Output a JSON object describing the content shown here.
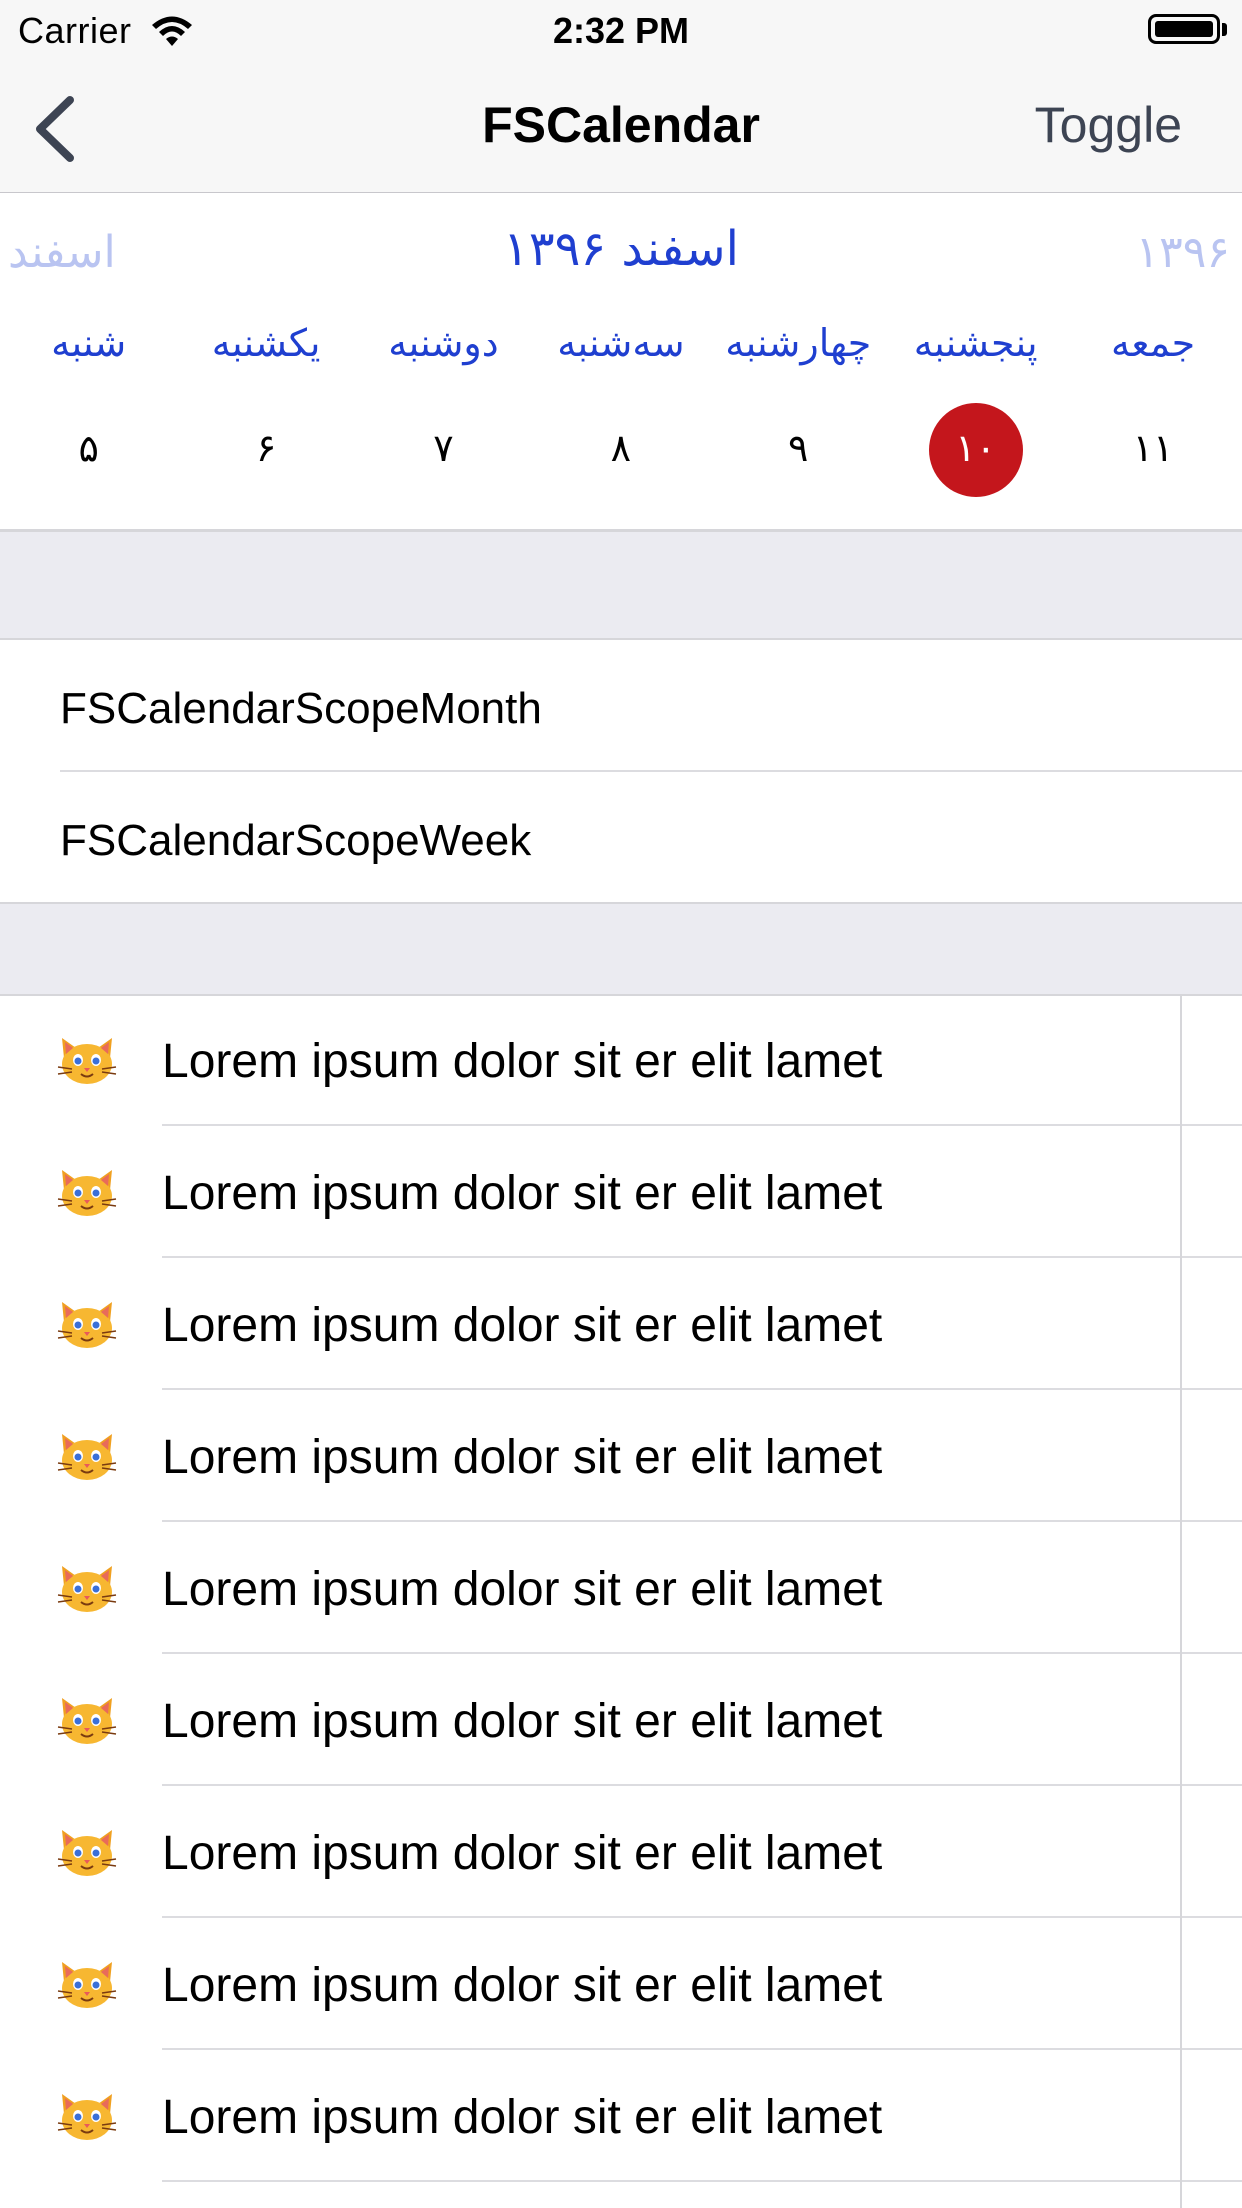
{
  "status_bar": {
    "carrier": "Carrier",
    "time": "2:32 PM"
  },
  "nav": {
    "title": "FSCalendar",
    "toggle_label": "Toggle"
  },
  "calendar": {
    "prev_label": "اسفند",
    "title": "اسفند ۱۳۹۶",
    "next_label": "۱۳۹۶",
    "weekdays": [
      "شنبه",
      "یکشنبه",
      "دوشنبه",
      "سه‌شنبه",
      "چهارشنبه",
      "پنجشنبه",
      "جمعه"
    ],
    "days": [
      "۵",
      "۶",
      "۷",
      "۸",
      "۹",
      "۱۰",
      "۱۱"
    ],
    "selected_day": "۱۰",
    "accent_color": "#1f3fd0",
    "today_color": "#c4161c"
  },
  "scope_options": [
    "FSCalendarScopeMonth",
    "FSCalendarScopeWeek"
  ],
  "list_items": [
    "Lorem ipsum dolor sit er elit lamet",
    "Lorem ipsum dolor sit er elit lamet",
    "Lorem ipsum dolor sit er elit lamet",
    "Lorem ipsum dolor sit er elit lamet",
    "Lorem ipsum dolor sit er elit lamet",
    "Lorem ipsum dolor sit er elit lamet",
    "Lorem ipsum dolor sit er elit lamet",
    "Lorem ipsum dolor sit er elit lamet",
    "Lorem ipsum dolor sit er elit lamet"
  ],
  "list_icon": "cat-face-icon"
}
